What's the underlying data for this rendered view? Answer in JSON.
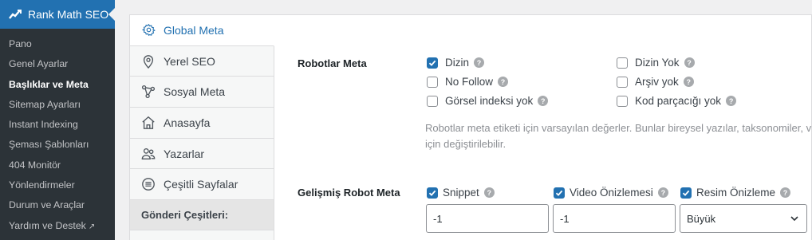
{
  "sidebar": {
    "parent_label": "Rank Math SEO",
    "items": [
      {
        "label": "Pano"
      },
      {
        "label": "Genel Ayarlar"
      },
      {
        "label": "Başlıklar ve Meta"
      },
      {
        "label": "Sitemap Ayarları"
      },
      {
        "label": "Instant Indexing"
      },
      {
        "label": "Şeması Şablonları"
      },
      {
        "label": "404 Monitör"
      },
      {
        "label": "Yönlendirmeler"
      },
      {
        "label": "Durum ve Araçlar"
      },
      {
        "label": "Yardım ve Destek"
      }
    ],
    "current_index": 2
  },
  "tabs": [
    {
      "label": "Global Meta",
      "icon": "gear-icon"
    },
    {
      "label": "Yerel SEO",
      "icon": "location-pin-icon"
    },
    {
      "label": "Sosyal Meta",
      "icon": "share-nodes-icon"
    },
    {
      "label": "Anasayfa",
      "icon": "home-icon"
    },
    {
      "label": "Yazarlar",
      "icon": "users-icon"
    },
    {
      "label": "Çeşitli Sayfalar",
      "icon": "list-circle-icon"
    }
  ],
  "tab_section": "Gönderi Çeşitleri:",
  "robots": {
    "label": "Robotlar Meta",
    "options": [
      {
        "label": "Dizin",
        "checked": true
      },
      {
        "label": "Dizin Yok",
        "checked": false
      },
      {
        "label": "No Follow",
        "checked": false
      },
      {
        "label": "Arşiv yok",
        "checked": false
      },
      {
        "label": "Görsel indeksi yok",
        "checked": false
      },
      {
        "label": "Kod parçacığı yok",
        "checked": false
      }
    ],
    "description": "Robotlar meta etiketi için varsayılan değerler. Bunlar bireysel yazılar, taksonomiler, vb. için değiştirilebilir."
  },
  "advanced": {
    "label": "Gelişmiş Robot Meta",
    "options": [
      {
        "label": "Snippet",
        "checked": true,
        "value": "-1"
      },
      {
        "label": "Video Önizlemesi",
        "checked": true,
        "value": "-1"
      },
      {
        "label": "Resim Önizleme",
        "checked": true,
        "value": "Büyük"
      }
    ]
  },
  "colors": {
    "accent": "#2271b1",
    "sidebar_bg": "#1d2327",
    "submenu_bg": "#2c3338"
  }
}
